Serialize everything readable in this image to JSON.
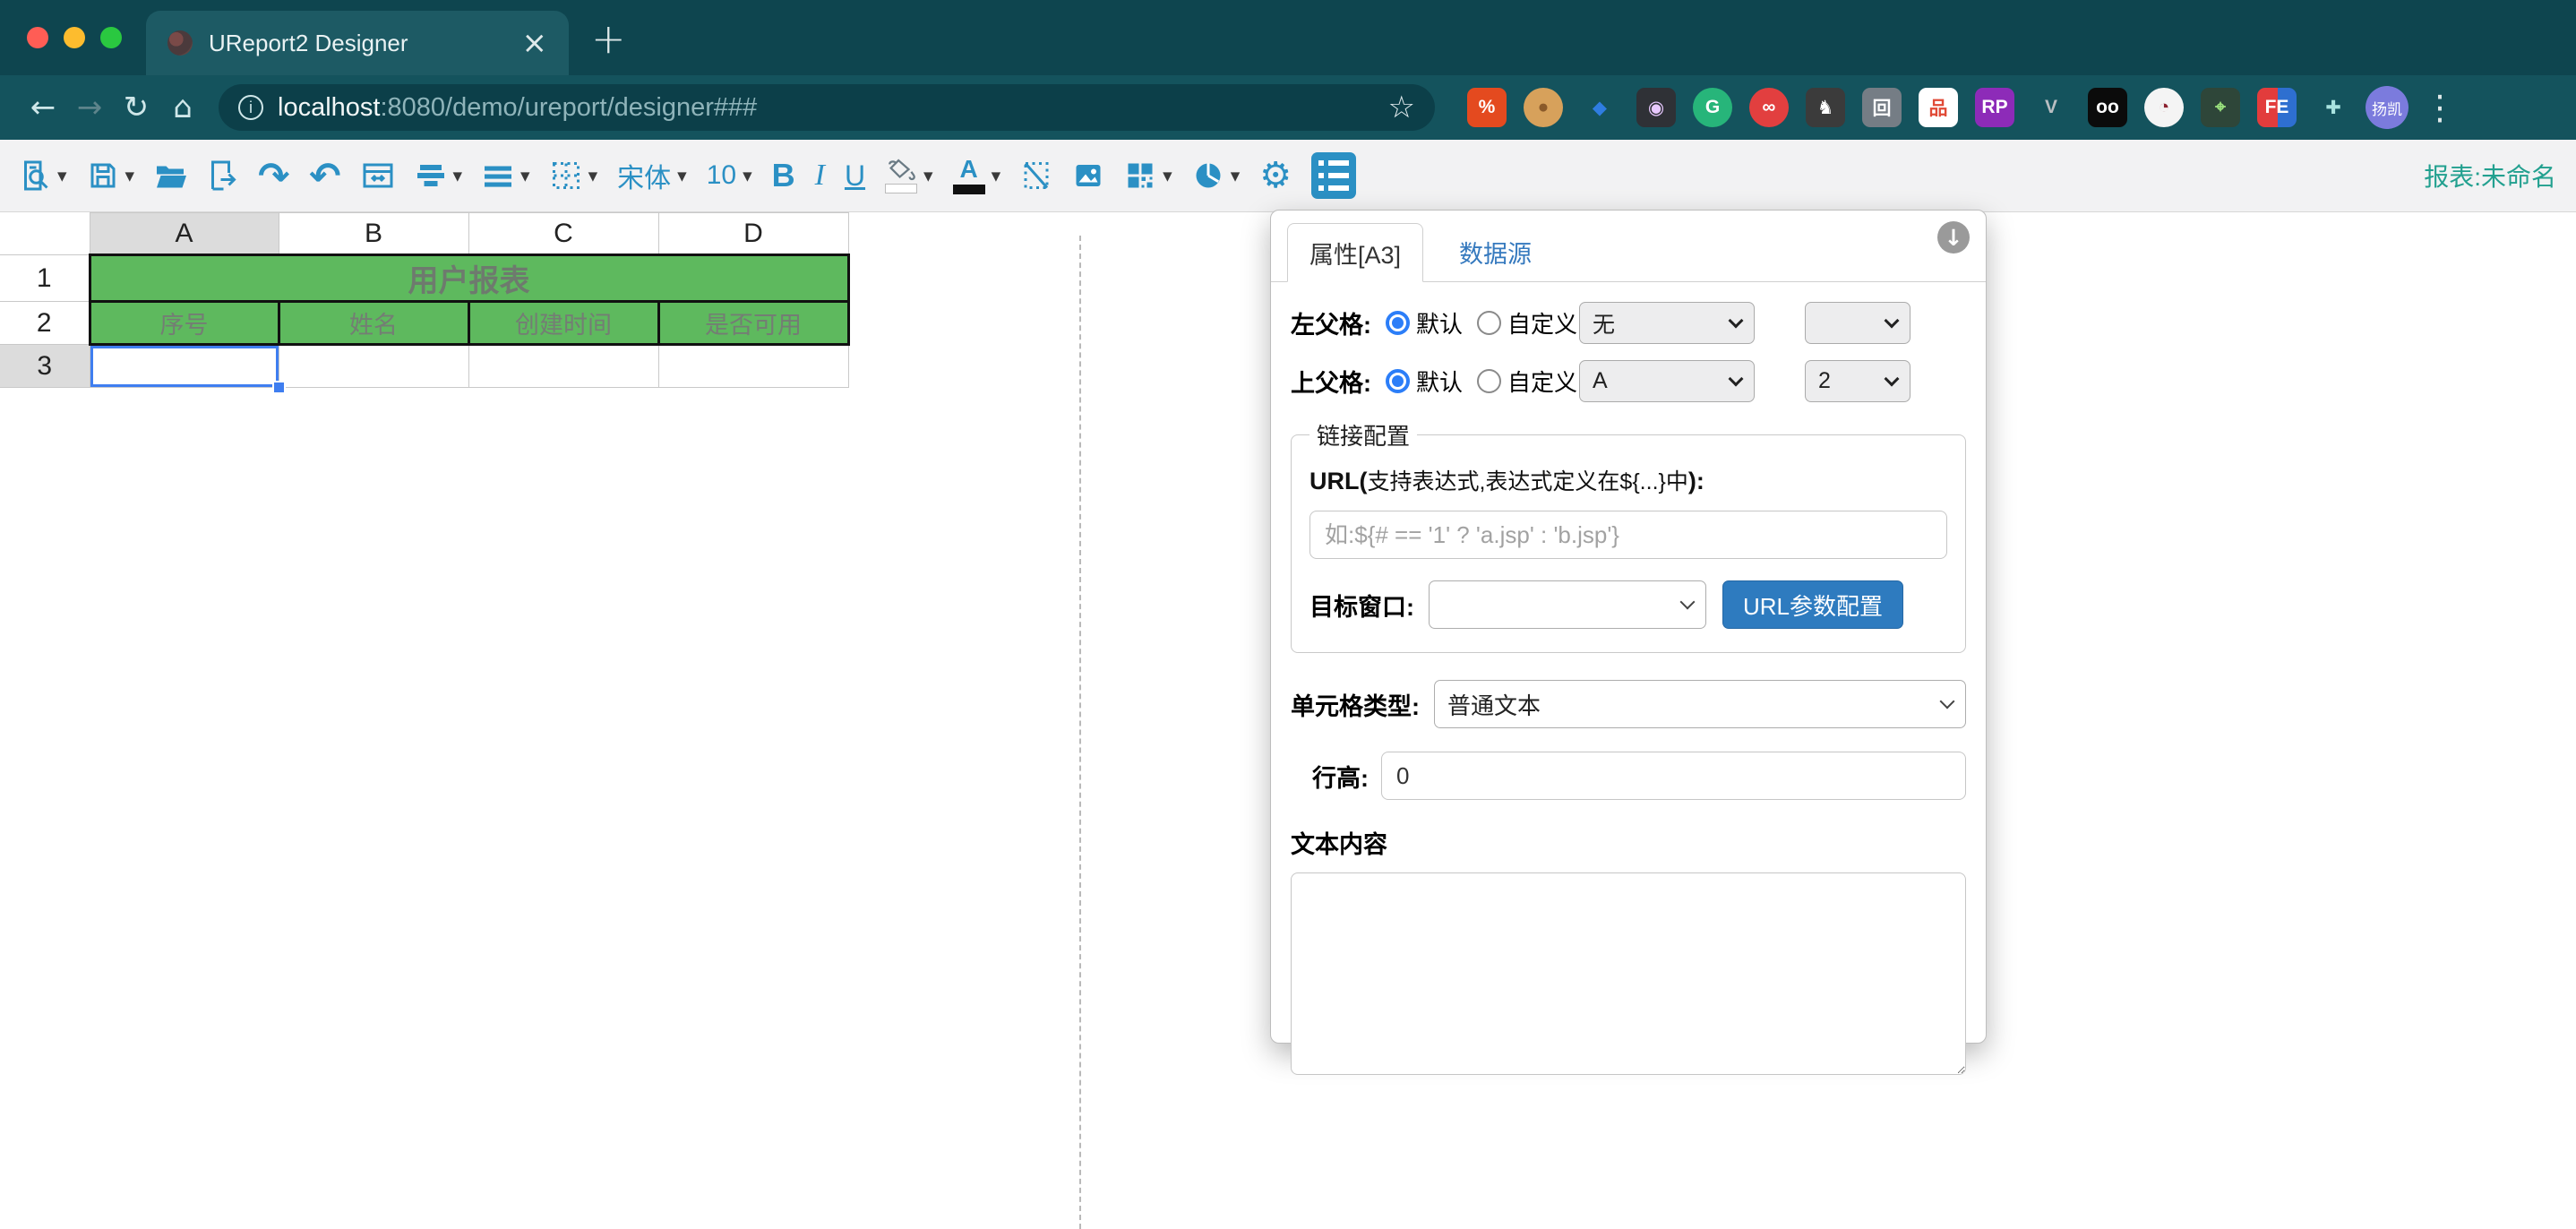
{
  "browser": {
    "tab_title": "UReport2 Designer",
    "close_tab": "×",
    "new_tab": "+",
    "url_host": "localhost",
    "url_rest": ":8080/demo/ureport/designer###",
    "avatar_text": "扬凯",
    "extensions": [
      {
        "name": "ext-red-dev",
        "glyph": "%",
        "bg": "#e44a1f",
        "fg": "#ffffff",
        "shape": "rounded"
      },
      {
        "name": "ext-cookie",
        "glyph": "●",
        "bg": "#d7a15b",
        "fg": "#8a5a2a",
        "shape": "circle"
      },
      {
        "name": "ext-blue-drop",
        "glyph": "◆",
        "bg": "transparent",
        "fg": "#2f7de1",
        "shape": "circle"
      },
      {
        "name": "ext-camera",
        "glyph": "◉",
        "bg": "#2f3136",
        "fg": "#e8c8ff",
        "shape": "rounded"
      },
      {
        "name": "ext-grammarly",
        "glyph": "G",
        "bg": "#27b57a",
        "fg": "#ffffff",
        "shape": "circle"
      },
      {
        "name": "ext-infinity",
        "glyph": "∞",
        "bg": "#e23f3f",
        "fg": "#ffffff",
        "shape": "circle"
      },
      {
        "name": "ext-cat",
        "glyph": "♞",
        "bg": "#3b3b3b",
        "fg": "#ffffff",
        "shape": "rounded"
      },
      {
        "name": "ext-frame",
        "glyph": "回",
        "bg": "#757d85",
        "fg": "#ffffff",
        "shape": "rounded"
      },
      {
        "name": "ext-org-tree",
        "glyph": "品",
        "bg": "#ffffff",
        "fg": "#e04a36",
        "shape": "rounded"
      },
      {
        "name": "ext-axure-rp",
        "glyph": "RP",
        "bg": "#8d2bb8",
        "fg": "#ffffff",
        "shape": "rounded"
      },
      {
        "name": "ext-vue",
        "glyph": "V",
        "bg": "transparent",
        "fg": "#b9bec2",
        "shape": "rounded"
      },
      {
        "name": "ext-oo",
        "glyph": "oo",
        "bg": "#0b0b0b",
        "fg": "#ffffff",
        "shape": "rounded"
      },
      {
        "name": "ext-compass",
        "glyph": "◔",
        "bg": "#f4f4f4",
        "fg": "#8c2230",
        "shape": "circle"
      },
      {
        "name": "ext-picker",
        "glyph": "⌖",
        "bg": "#2e4639",
        "fg": "#9be37e",
        "shape": "rounded"
      },
      {
        "name": "ext-fe",
        "glyph": "FE",
        "bg": "linear-gradient(90deg,#e23c3c 52%,#2e6fd0 52%)",
        "fg": "#ffffff",
        "shape": "rounded"
      },
      {
        "name": "ext-puzzle",
        "glyph": "✚",
        "bg": "transparent",
        "fg": "#a9e3e0",
        "shape": "rounded"
      }
    ]
  },
  "toolbar": {
    "font_name": "宋体",
    "font_size": "10",
    "bold_label": "B",
    "italic_label": "I",
    "underline_label": "U",
    "font_color_label": "A",
    "report_name": "报表:未命名",
    "icons": [
      "preview-report",
      "save",
      "open-file",
      "import-excel",
      "redo",
      "undo",
      "merge-cell",
      "align",
      "border-lines",
      "cell-borders",
      "font-family",
      "font-size",
      "bold",
      "italic",
      "underline",
      "fill-color",
      "font-color",
      "slash-cell",
      "insert-image",
      "qrcode",
      "chart",
      "settings",
      "property-panel-toggle"
    ]
  },
  "sheet": {
    "selected_cell": "A3",
    "columns": [
      "A",
      "B",
      "C",
      "D"
    ],
    "rows": [
      "1",
      "2",
      "3"
    ],
    "title_cell": "用户报表",
    "header_cells": [
      "序号",
      "姓名",
      "创建时间",
      "是否可用"
    ]
  },
  "panel": {
    "tabs": [
      {
        "label": "属性[A3]"
      },
      {
        "label": "数据源"
      }
    ],
    "collapse_icon": "↓",
    "left_parent": {
      "label": "左父格:",
      "radio_default": "默认",
      "radio_custom": "自定义",
      "select1": "无",
      "select2": ""
    },
    "top_parent": {
      "label": "上父格:",
      "radio_default": "默认",
      "radio_custom": "自定义",
      "select1": "A",
      "select2": "2"
    },
    "link_config": {
      "legend": "链接配置",
      "url_label_prefix": "URL(",
      "url_label_mid": "支持表达式,表达式定义在${...}中",
      "url_label_suffix": "):",
      "url_placeholder": "如:${# == '1' ? 'a.jsp' : 'b.jsp'}",
      "target_label": "目标窗口:",
      "url_param_button": "URL参数配置"
    },
    "cell_type": {
      "label": "单元格类型:",
      "value": "普通文本"
    },
    "row_height": {
      "label": "行高:",
      "value": "0"
    },
    "text_content_label": "文本内容"
  }
}
